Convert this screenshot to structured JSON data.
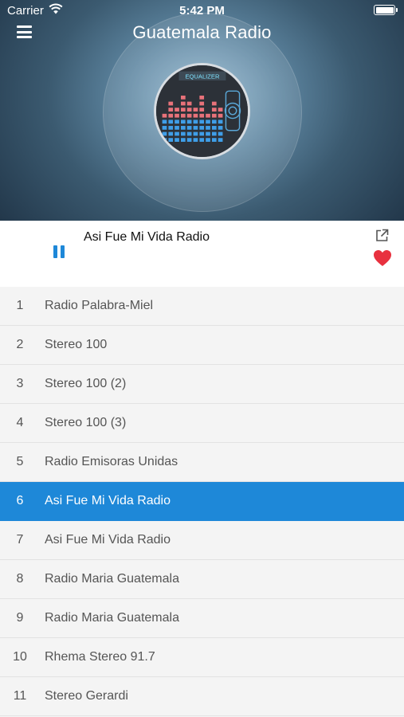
{
  "status_bar": {
    "carrier": "Carrier",
    "time": "5:42 PM",
    "battery": "full"
  },
  "header": {
    "title": "Guatemala Radio",
    "menu_icon": "hamburger-menu-icon"
  },
  "artwork": {
    "label": "EQUALIZER"
  },
  "now_playing": {
    "title": "Asi Fue Mi Vida Radio",
    "state": "playing",
    "accent_color": "#1e88d8",
    "favorite_color": "#e8313f"
  },
  "stations": [
    {
      "num": "1",
      "name": "Radio Palabra-Miel"
    },
    {
      "num": "2",
      "name": "Stereo 100"
    },
    {
      "num": "3",
      "name": "Stereo 100 (2)"
    },
    {
      "num": "4",
      "name": "Stereo 100 (3)"
    },
    {
      "num": "5",
      "name": "Radio Emisoras Unidas"
    },
    {
      "num": "6",
      "name": "Asi Fue Mi Vida Radio",
      "active": true
    },
    {
      "num": "7",
      "name": "Asi Fue Mi Vida Radio"
    },
    {
      "num": "8",
      "name": "Radio Maria Guatemala"
    },
    {
      "num": "9",
      "name": "Radio Maria Guatemala"
    },
    {
      "num": "10",
      "name": "Rhema Stereo 91.7"
    },
    {
      "num": "11",
      "name": "Stereo Gerardi"
    }
  ]
}
